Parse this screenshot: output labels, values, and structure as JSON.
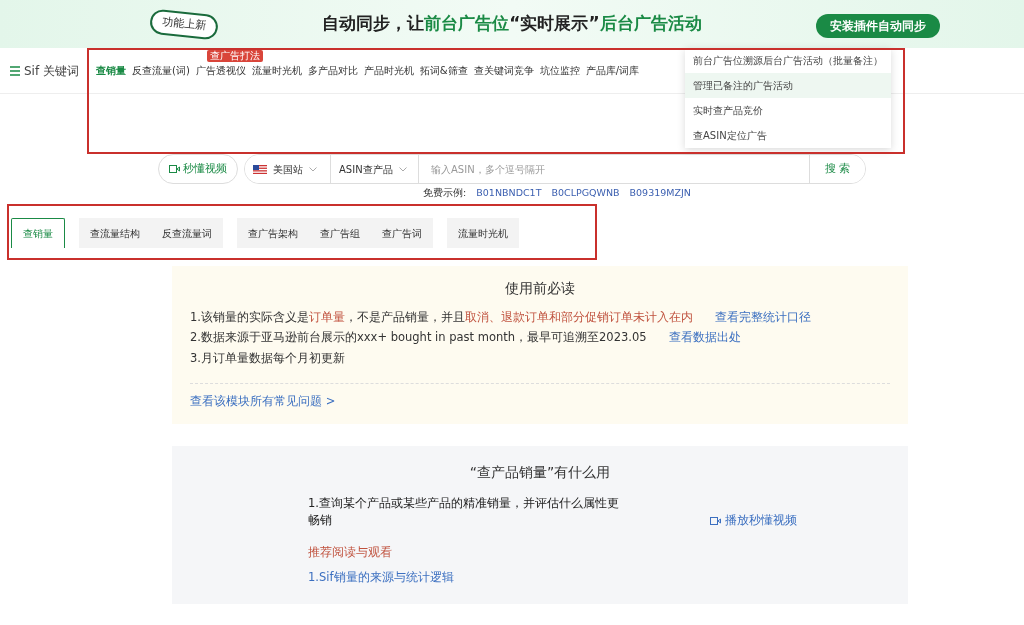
{
  "banner": {
    "badge": "功能上新",
    "headline": [
      {
        "text": "自动同步，让",
        "accent": false
      },
      {
        "text": "前台广告位",
        "accent": true
      },
      {
        "text": "“实时展示”",
        "accent": false
      },
      {
        "text": "后台广告活动",
        "accent": true
      }
    ],
    "button": "安装插件自动同步"
  },
  "nav": {
    "brand": "Sif 关键词",
    "items": [
      {
        "label": "查销量",
        "selected": true
      },
      {
        "label": "反查流量(词)",
        "selected": false
      },
      {
        "label": "广告透视仪",
        "selected": false,
        "badge": "查广告打法"
      },
      {
        "label": "流量时光机",
        "selected": false
      },
      {
        "label": "多产品对比",
        "selected": false
      },
      {
        "label": "产品时光机",
        "selected": false
      },
      {
        "label": "拓词&筛查",
        "selected": false
      },
      {
        "label": "查关键词竞争",
        "selected": false
      },
      {
        "label": "坑位监控",
        "selected": false
      },
      {
        "label": "产品库/词库",
        "selected": false
      }
    ]
  },
  "dropdown": [
    {
      "label": "前台广告位溯源后台广告活动（批量备注）",
      "selected": false
    },
    {
      "label": "管理已备注的广告活动",
      "selected": true
    },
    {
      "label": "实时查产品竞价",
      "selected": false
    },
    {
      "label": "查ASIN定位广告",
      "selected": false
    }
  ],
  "search": {
    "video_button": "秒懂视频",
    "site": "美国站",
    "mode": "ASIN查产品",
    "placeholder": "输入ASIN，多个逗号隔开",
    "button": "搜 索"
  },
  "examples": {
    "label": "免费示例:",
    "asins": [
      "B01NBNDC1T",
      "B0CLPGQWNB",
      "B09319MZJN"
    ]
  },
  "tab_groups": [
    [
      {
        "label": "查销量",
        "selected": true
      }
    ],
    [
      {
        "label": "查流量结构",
        "selected": false
      },
      {
        "label": "反查流量词",
        "selected": false
      }
    ],
    [
      {
        "label": "查广告架构",
        "selected": false
      },
      {
        "label": "查广告组",
        "selected": false
      },
      {
        "label": "查广告词",
        "selected": false
      }
    ],
    [
      {
        "label": "流量时光机",
        "selected": false
      }
    ]
  ],
  "notice": {
    "title": "使用前必读",
    "lines": [
      {
        "parts": [
          {
            "text": "1.该销量的实际含义是",
            "accent": false
          },
          {
            "text": "订单量",
            "accent": true
          },
          {
            "text": "，不是产品销量，并且",
            "accent": false
          },
          {
            "text": "取消、退款订单和部分促销订单未计入在内",
            "accent": true
          }
        ],
        "link": "查看完整统计口径"
      },
      {
        "parts": [
          {
            "text": "2.数据来源于亚马逊前台展示的xxx+ bought in past month，最早可追溯至2023.05",
            "accent": false
          }
        ],
        "link": "查看数据出处"
      },
      {
        "parts": [
          {
            "text": "3.月订单量数据每个月初更新",
            "accent": false
          }
        ]
      }
    ],
    "faq_link": "查看该模块所有常见问题 >"
  },
  "usage": {
    "title": "“查产品销量”有什么用",
    "description": "1.查询某个产品或某些产品的精准销量，并评估什么属性更畅销",
    "video_link": "播放秒懂视频",
    "recommend_heading": "推荐阅读与观看",
    "articles": [
      "1.Sif销量的来源与统计逻辑"
    ]
  }
}
